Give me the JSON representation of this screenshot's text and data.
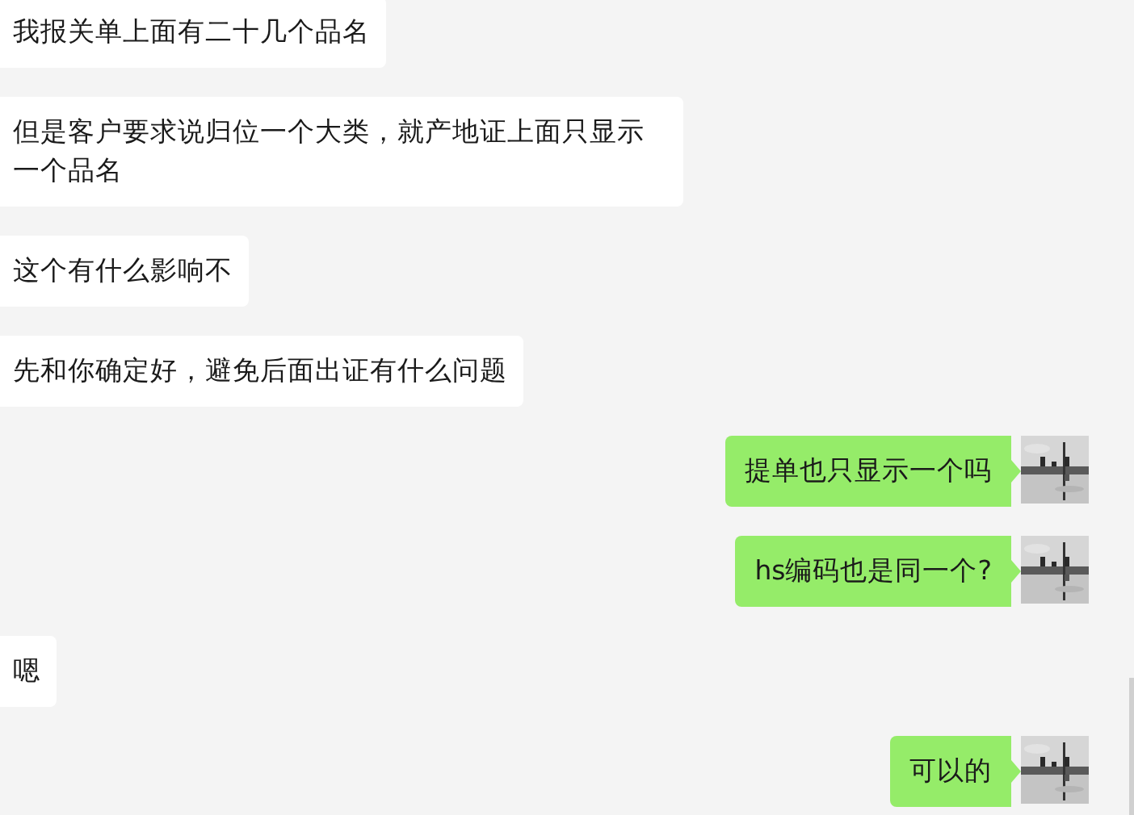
{
  "messages": [
    {
      "kind": "received",
      "text": "我报关单上面有二十几个品名"
    },
    {
      "kind": "received",
      "text": "但是客户要求说归位一个大类，就产地证上面只显示一个品名"
    },
    {
      "kind": "received",
      "text": "这个有什么影响不"
    },
    {
      "kind": "received",
      "text": "先和你确定好，避免后面出证有什么问题"
    },
    {
      "kind": "sent",
      "text": "提单也只显示一个吗"
    },
    {
      "kind": "sent",
      "text": "hs编码也是同一个?"
    },
    {
      "kind": "received",
      "text": "嗯"
    },
    {
      "kind": "sent",
      "text": "可以的"
    }
  ]
}
